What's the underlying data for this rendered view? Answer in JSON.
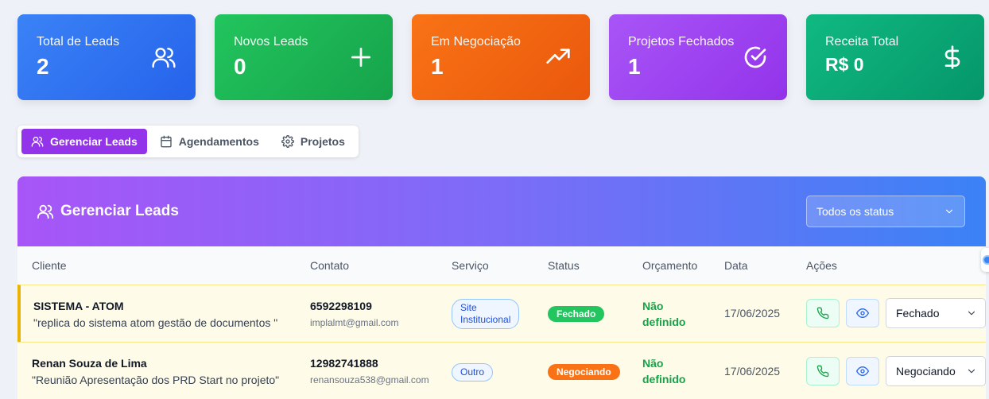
{
  "stats": [
    {
      "label": "Total de Leads",
      "value": "2",
      "icon": "users-icon"
    },
    {
      "label": "Novos Leads",
      "value": "0",
      "icon": "plus-icon"
    },
    {
      "label": "Em Negociação",
      "value": "1",
      "icon": "trending-up-icon"
    },
    {
      "label": "Projetos Fechados",
      "value": "1",
      "icon": "check-circle-icon"
    },
    {
      "label": "Receita Total",
      "value": "R$ 0",
      "icon": "dollar-icon"
    }
  ],
  "tabs": [
    {
      "label": "Gerenciar Leads",
      "icon": "users-icon",
      "active": true
    },
    {
      "label": "Agendamentos",
      "icon": "calendar-icon",
      "active": false
    },
    {
      "label": "Projetos",
      "icon": "gear-icon",
      "active": false
    }
  ],
  "panel": {
    "title": "Gerenciar Leads",
    "filter_value": "Todos os status"
  },
  "table": {
    "headers": [
      "Cliente",
      "Contato",
      "Serviço",
      "Status",
      "Orçamento",
      "Data",
      "Ações"
    ],
    "rows": [
      {
        "client_name": "SISTEMA - ATOM",
        "client_desc": "\"replica do sistema atom gestão de documentos \"",
        "phone": "6592298109",
        "email": "implalmt@gmail.com",
        "service_line1": "Site",
        "service_line2": "Institucional",
        "status": "Fechado",
        "status_color": "#22c55e",
        "budget_line1": "Não",
        "budget_line2": "definido",
        "date": "17/06/2025",
        "select_value": "Fechado"
      },
      {
        "client_name": "Renan Souza de Lima",
        "client_desc": "\"Reunião Apresentação dos PRD Start no projeto\"",
        "phone": "12982741888",
        "email": "renansouza538@gmail.com",
        "service_line1": "Outro",
        "service_line2": "",
        "status": "Negociando",
        "status_color": "#f97316",
        "budget_line1": "Não",
        "budget_line2": "definido",
        "date": "17/06/2025",
        "select_value": "Negociando"
      }
    ]
  }
}
